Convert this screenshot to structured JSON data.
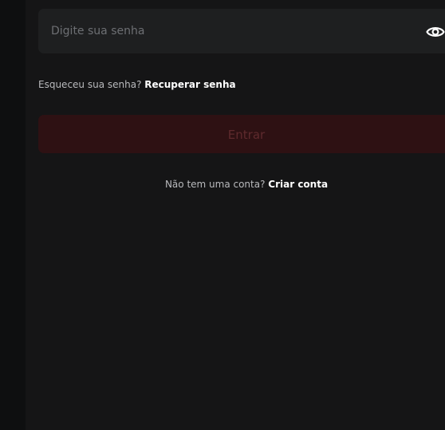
{
  "login_form": {
    "password_field": {
      "placeholder": "Digite sua senha",
      "value": "",
      "toggle_icon": "eye-icon"
    },
    "forgot_password": {
      "prompt": "Esqueceu sua senha?",
      "link_label": "Recuperar senha"
    },
    "submit": {
      "label": "Entrar",
      "state": "disabled"
    },
    "signup": {
      "prompt": "Não tem uma conta?",
      "link_label": "Criar conta"
    }
  },
  "colors": {
    "background": "#111112",
    "panel": "#151516",
    "field_background": "#1e1f20",
    "placeholder_text": "#6d6f73",
    "button_disabled_background": "#2e1113",
    "button_disabled_text": "#5e2a2d",
    "link_text": "#ffffff",
    "muted_text": "#b9babd"
  }
}
